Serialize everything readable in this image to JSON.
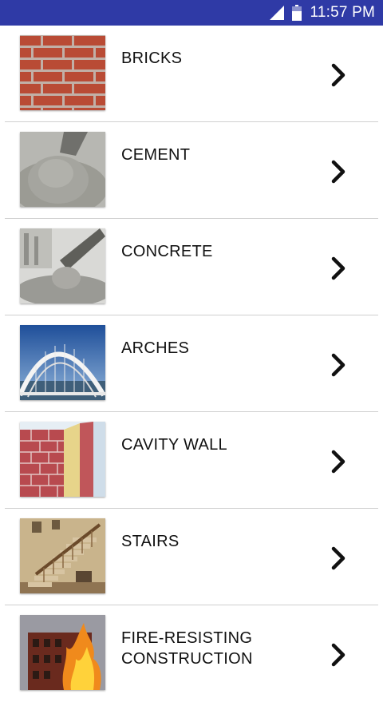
{
  "status_bar": {
    "time": "11:57 PM",
    "icons": [
      "signal-icon",
      "battery-icon"
    ],
    "background": "#2f3aa6"
  },
  "items": [
    {
      "label": "BRICKS",
      "image": "bricks-image"
    },
    {
      "label": "CEMENT",
      "image": "cement-image"
    },
    {
      "label": "CONCRETE",
      "image": "concrete-image"
    },
    {
      "label": "ARCHES",
      "image": "arch-bridge-image"
    },
    {
      "label": "CAVITY WALL",
      "image": "cavity-wall-image"
    },
    {
      "label": "STAIRS",
      "image": "stairs-image"
    },
    {
      "label": "FIRE-RESISTING\nCONSTRUCTION",
      "image": "fire-building-image"
    }
  ],
  "chevron_icon": "chevron-right-icon"
}
